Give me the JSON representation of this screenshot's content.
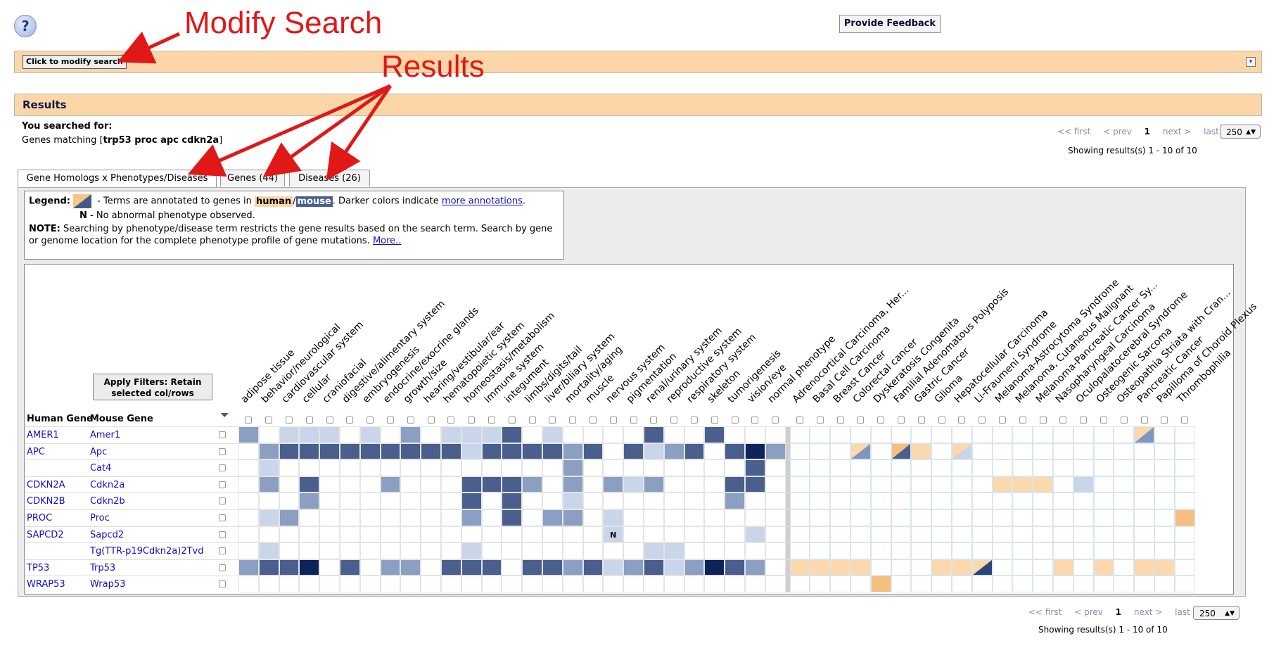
{
  "help": {
    "icon": "?"
  },
  "feedback_label": "Provide Feedback",
  "modify_label": "Click to modify search",
  "results_title": "Results",
  "search": {
    "prefix": "You searched for:",
    "line_prefix": "Genes matching [",
    "terms": "trp53 proc apc cdkn2a",
    "line_suffix": "]"
  },
  "pager": {
    "first": "<< first",
    "prev": "< prev",
    "page": "1",
    "next": "next >",
    "last": "last >>",
    "per_page": "250",
    "showing": "Showing results(s) 1 - 10 of 10"
  },
  "tabs": [
    "Gene Homologs x Phenotypes/Diseases",
    "Genes (44)",
    "Diseases (26)"
  ],
  "legend": {
    "label": "Legend:",
    "text1": " - Terms are annotated to genes in ",
    "human": "human",
    "slash": "/",
    "mouse": "mouse",
    "text2": ". Darker colors indicate ",
    "more_link": "more annotations",
    "text3": ".",
    "n_label": "N",
    "n_text": " - No abnormal phenotype observed.",
    "note_label": "NOTE:",
    "note_text": " Searching by phenotype/disease term restricts the gene results based on the search term. Search by gene or genome location for the complete phenotype profile of gene mutations. ",
    "note_link": "More.."
  },
  "grid": {
    "human_header": "Human Gene",
    "mouse_header": "Mouse Gene",
    "apply_label": "Apply Filters: Retain selected col/rows",
    "phenotypes": [
      "adipose tissue",
      "behavior/neurological",
      "cardiovascular system",
      "cellular",
      "craniofacial",
      "digestive/alimentary system",
      "embryogenesis",
      "endocrine/exocrine glands",
      "growth/size",
      "hearing/vestibular/ear",
      "hematopoietic system",
      "homeostasis/metabolism",
      "immune system",
      "integument",
      "limbs/digits/tail",
      "liver/biliary system",
      "mortality/aging",
      "muscle",
      "nervous system",
      "pigmentation",
      "renal/urinary system",
      "reproductive system",
      "respiratory system",
      "skeleton",
      "tumorigenesis",
      "vision/eye",
      "normal phenotype"
    ],
    "diseases": [
      "Adrenocortical Carcinoma, Her...",
      "Basal Cell Carcinoma",
      "Breast Cancer",
      "Colorectal cancer",
      "Dyskeratosis Congenita",
      "Familial Adenomatous Polyposis",
      "Gastric Cancer",
      "Glioma",
      "Hepatocellular Carcinoma",
      "Li-Fraumeni Syndrome",
      "Melanoma-Astrocytoma Syndrome",
      "Melanoma, Cutaneous Malignant",
      "Melanoma-Pancreatic Cancer Sy...",
      "Nasopharyngeal Carcinoma",
      "Oculopalatocerebral Syndrome",
      "Osteogenic Sarcoma",
      "Osteopathia Striata with Cran...",
      "Pancreatic Cancer",
      "Papilloma of Choroid Plexus",
      "Thrombophilia"
    ],
    "rows": [
      {
        "human": "AMER1",
        "mouse": "Amer1"
      },
      {
        "human": "APC",
        "mouse": "Apc"
      },
      {
        "human": "",
        "mouse": "Cat4"
      },
      {
        "human": "CDKN2A",
        "mouse": "Cdkn2a"
      },
      {
        "human": "CDKN2B",
        "mouse": "Cdkn2b"
      },
      {
        "human": "PROC",
        "mouse": "Proc"
      },
      {
        "human": "SAPCD2",
        "mouse": "Sapcd2"
      },
      {
        "human": "",
        "mouse": "Tg(TTR-p19Cdkn2a)2Tvd"
      },
      {
        "human": "TP53",
        "mouse": "Trp53"
      },
      {
        "human": "WRAP53",
        "mouse": "Wrap53"
      }
    ],
    "pheno_levels": [
      [
        2,
        0,
        1,
        1,
        1,
        0,
        1,
        0,
        2,
        0,
        1,
        1,
        1,
        4,
        0,
        1,
        0,
        0,
        0,
        0,
        4,
        0,
        0,
        4,
        0,
        0,
        0
      ],
      [
        0,
        2,
        4,
        4,
        4,
        4,
        4,
        4,
        4,
        4,
        4,
        1,
        4,
        4,
        4,
        4,
        2,
        4,
        0,
        4,
        1,
        2,
        4,
        0,
        4,
        5,
        2,
        2
      ],
      [
        0,
        1,
        0,
        0,
        0,
        0,
        0,
        0,
        0,
        0,
        0,
        0,
        0,
        0,
        0,
        0,
        2,
        0,
        0,
        0,
        0,
        0,
        0,
        0,
        0,
        4,
        0
      ],
      [
        0,
        2,
        0,
        4,
        0,
        0,
        0,
        2,
        0,
        0,
        0,
        4,
        4,
        4,
        2,
        0,
        2,
        0,
        2,
        1,
        2,
        0,
        0,
        0,
        4,
        4,
        0
      ],
      [
        0,
        0,
        0,
        2,
        0,
        0,
        0,
        0,
        0,
        0,
        0,
        4,
        0,
        4,
        0,
        0,
        1,
        0,
        0,
        0,
        0,
        0,
        0,
        0,
        2,
        0,
        0
      ],
      [
        0,
        1,
        2,
        0,
        0,
        0,
        0,
        0,
        0,
        0,
        0,
        2,
        0,
        3,
        0,
        2,
        2,
        0,
        1,
        0,
        0,
        0,
        0,
        0,
        0,
        0,
        0
      ],
      [
        0,
        0,
        0,
        0,
        0,
        0,
        0,
        0,
        0,
        0,
        0,
        0,
        0,
        0,
        0,
        0,
        0,
        0,
        9,
        0,
        0,
        0,
        0,
        0,
        0,
        1,
        0
      ],
      [
        0,
        1,
        0,
        0,
        0,
        0,
        0,
        0,
        0,
        0,
        0,
        1,
        0,
        0,
        0,
        0,
        0,
        0,
        0,
        0,
        1,
        1,
        0,
        0,
        0,
        0,
        0
      ],
      [
        2,
        4,
        4,
        5,
        0,
        4,
        0,
        2,
        2,
        0,
        4,
        4,
        4,
        0,
        4,
        4,
        2,
        4,
        1,
        2,
        4,
        1,
        2,
        5,
        4,
        2,
        0
      ],
      [
        0,
        0,
        0,
        0,
        0,
        0,
        0,
        0,
        0,
        0,
        0,
        0,
        0,
        0,
        0,
        0,
        0,
        0,
        0,
        0,
        0,
        0,
        0,
        0,
        0,
        0,
        0
      ]
    ],
    "disease_levels": [
      [
        0,
        0,
        0,
        0,
        0,
        0,
        0,
        0,
        0,
        0,
        0,
        0,
        0,
        0,
        0,
        0,
        0,
        3,
        0,
        0
      ],
      [
        0,
        0,
        0,
        3,
        0,
        4,
        1,
        0,
        5,
        0,
        0,
        0,
        0,
        0,
        0,
        0,
        0,
        0,
        0,
        0
      ],
      [
        0,
        0,
        0,
        0,
        0,
        0,
        0,
        0,
        0,
        0,
        0,
        0,
        0,
        0,
        0,
        0,
        0,
        0,
        0,
        0
      ],
      [
        0,
        0,
        0,
        0,
        0,
        0,
        0,
        0,
        0,
        0,
        1,
        1,
        1,
        0,
        6,
        0,
        0,
        0,
        0,
        0
      ],
      [
        0,
        0,
        0,
        0,
        0,
        0,
        0,
        0,
        0,
        0,
        0,
        0,
        0,
        0,
        0,
        0,
        0,
        0,
        0,
        0
      ],
      [
        0,
        0,
        0,
        0,
        0,
        0,
        0,
        0,
        0,
        0,
        0,
        0,
        0,
        0,
        0,
        0,
        0,
        0,
        0,
        2
      ],
      [
        0,
        0,
        0,
        0,
        0,
        0,
        0,
        0,
        0,
        0,
        0,
        0,
        0,
        0,
        0,
        0,
        0,
        0,
        0,
        0
      ],
      [
        0,
        0,
        0,
        0,
        0,
        0,
        0,
        0,
        0,
        0,
        0,
        0,
        0,
        0,
        0,
        0,
        0,
        0,
        0,
        0
      ],
      [
        1,
        1,
        1,
        1,
        0,
        0,
        0,
        1,
        1,
        7,
        0,
        0,
        0,
        1,
        0,
        1,
        0,
        1,
        1,
        0
      ],
      [
        0,
        0,
        0,
        0,
        2,
        0,
        0,
        0,
        0,
        0,
        0,
        0,
        0,
        0,
        0,
        0,
        0,
        0,
        0,
        0
      ]
    ],
    "n_marker": "N"
  },
  "annotations": {
    "modify": "Modify Search",
    "results": "Results"
  },
  "colors": {
    "accent_bar": "#fcd6a8",
    "link": "#1010c0",
    "annot_red": "#e01818"
  }
}
